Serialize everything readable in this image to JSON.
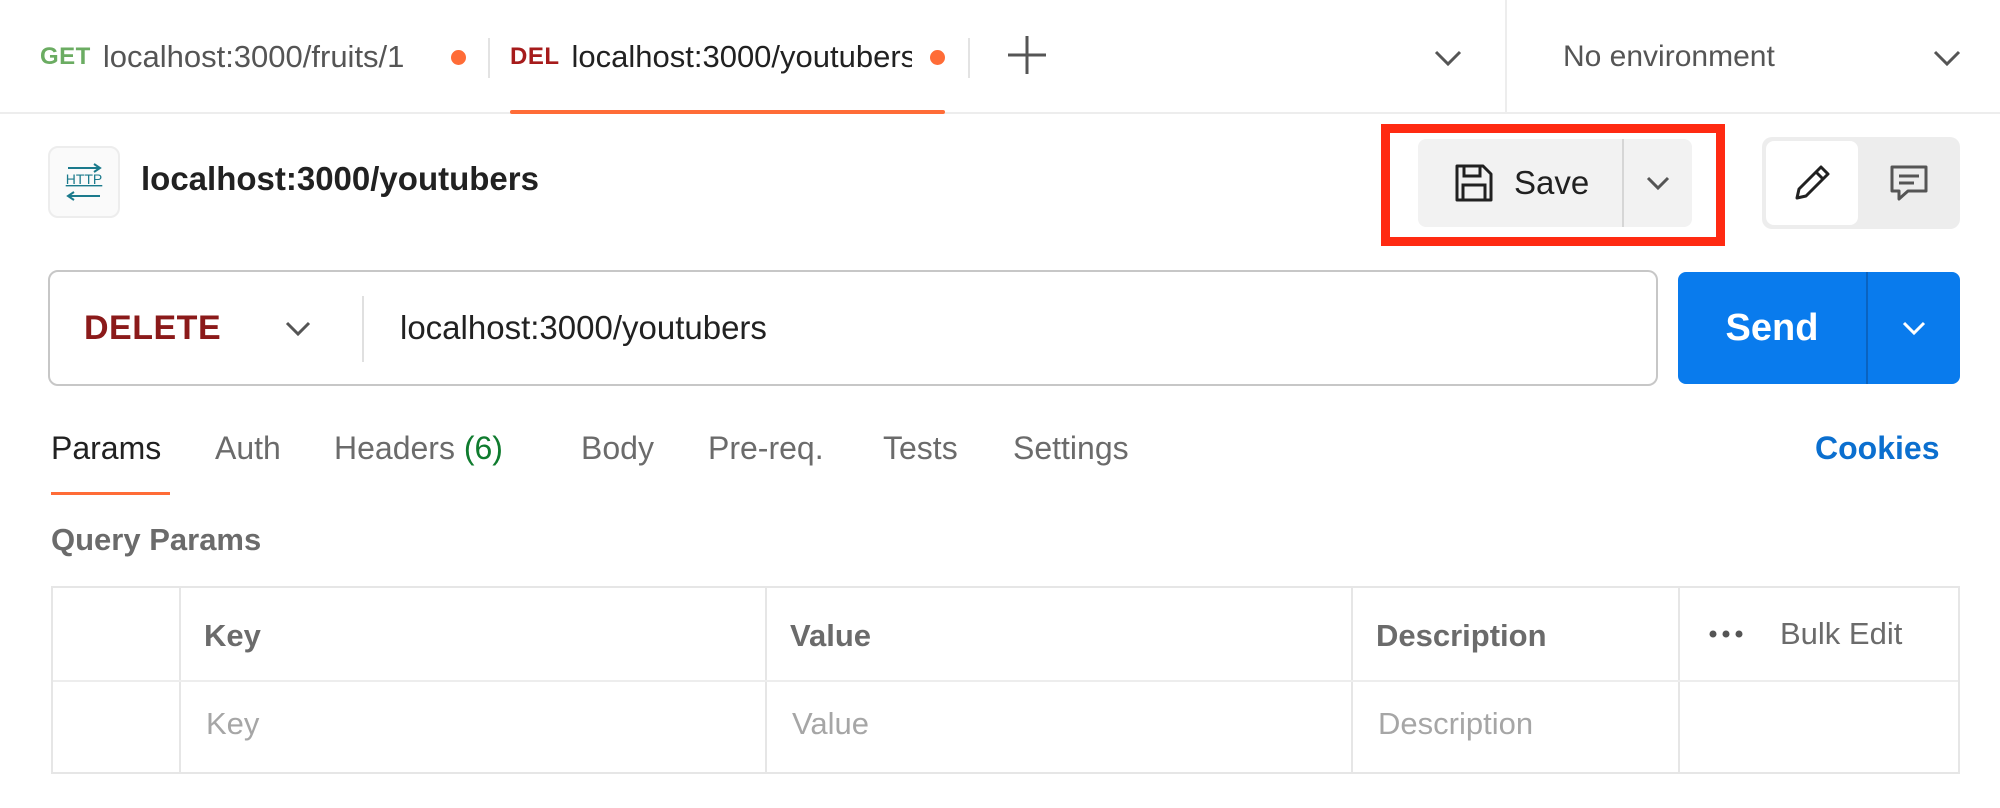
{
  "tabs": [
    {
      "method": "GET",
      "url": "localhost:3000/fruits/1",
      "unsaved": true,
      "active": false
    },
    {
      "method": "DEL",
      "url": "localhost:3000/youtubers",
      "unsaved": true,
      "active": true
    }
  ],
  "environment": {
    "label": "No environment"
  },
  "request": {
    "icon_text": "HTTP",
    "title": "localhost:3000/youtubers",
    "method": "DELETE",
    "url": "localhost:3000/youtubers"
  },
  "toolbar": {
    "save_label": "Save",
    "send_label": "Send"
  },
  "request_tabs": {
    "params": "Params",
    "auth": "Auth",
    "headers": "Headers",
    "headers_count": "(6)",
    "body": "Body",
    "prereq": "Pre-req.",
    "tests": "Tests",
    "settings": "Settings",
    "cookies": "Cookies"
  },
  "query_params": {
    "title": "Query Params",
    "columns": {
      "key": "Key",
      "value": "Value",
      "description": "Description"
    },
    "bulk_edit": "Bulk Edit",
    "placeholders": {
      "key": "Key",
      "value": "Value",
      "description": "Description"
    }
  },
  "colors": {
    "accent": "#ff6c37",
    "send": "#097bed",
    "get": "#6bac62",
    "delete": "#a61b1b",
    "highlight": "#ff2a12"
  },
  "icons": [
    "plus-icon",
    "chevron-down-icon",
    "http-icon",
    "save-icon",
    "pencil-icon",
    "comment-icon",
    "more-dots-icon"
  ]
}
